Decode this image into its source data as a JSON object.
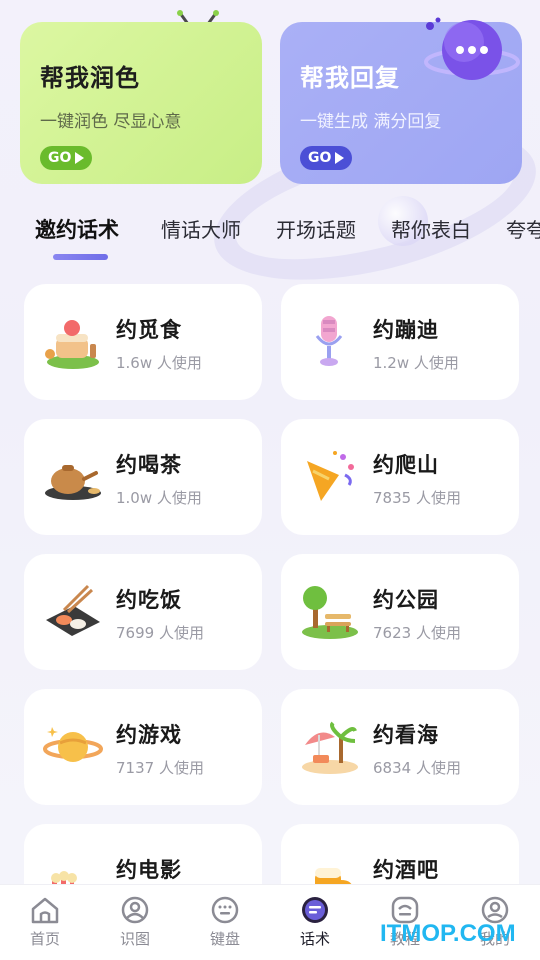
{
  "banners": [
    {
      "title": "帮我润色",
      "subtitle": "一键润色 尽显心意",
      "go_label": "GO",
      "accent": "#6abb2c"
    },
    {
      "title": "帮我回复",
      "subtitle": "一键生成 满分回复",
      "go_label": "GO",
      "accent": "#4b4fd6"
    }
  ],
  "tabs": [
    "邀约话术",
    "情话大师",
    "开场话题",
    "帮你表白",
    "夸夸"
  ],
  "active_tab": "邀约话术",
  "cards": [
    {
      "title": "约觅食",
      "usage": "1.6w 人使用",
      "icon": "food-icon"
    },
    {
      "title": "约蹦迪",
      "usage": "1.2w 人使用",
      "icon": "microphone-icon"
    },
    {
      "title": "约喝茶",
      "usage": "1.0w 人使用",
      "icon": "teapot-icon"
    },
    {
      "title": "约爬山",
      "usage": "7835 人使用",
      "icon": "party-popper-icon"
    },
    {
      "title": "约吃饭",
      "usage": "7699 人使用",
      "icon": "sushi-chopsticks-icon"
    },
    {
      "title": "约公园",
      "usage": "7623 人使用",
      "icon": "park-bench-icon"
    },
    {
      "title": "约游戏",
      "usage": "7137 人使用",
      "icon": "planet-icon"
    },
    {
      "title": "约看海",
      "usage": "6834 人使用",
      "icon": "beach-icon"
    },
    {
      "title": "约电影",
      "usage": "",
      "icon": "popcorn-icon"
    },
    {
      "title": "约酒吧",
      "usage": "",
      "icon": "beer-icon"
    }
  ],
  "bottom_nav": [
    {
      "label": "首页",
      "icon": "home-icon"
    },
    {
      "label": "识图",
      "icon": "image-recognize-icon"
    },
    {
      "label": "键盘",
      "icon": "keyboard-icon"
    },
    {
      "label": "话术",
      "icon": "chat-script-icon",
      "active": true
    },
    {
      "label": "教程",
      "icon": "tutorial-icon"
    },
    {
      "label": "我的",
      "icon": "profile-icon"
    }
  ],
  "watermark": "ITMOP.COM"
}
